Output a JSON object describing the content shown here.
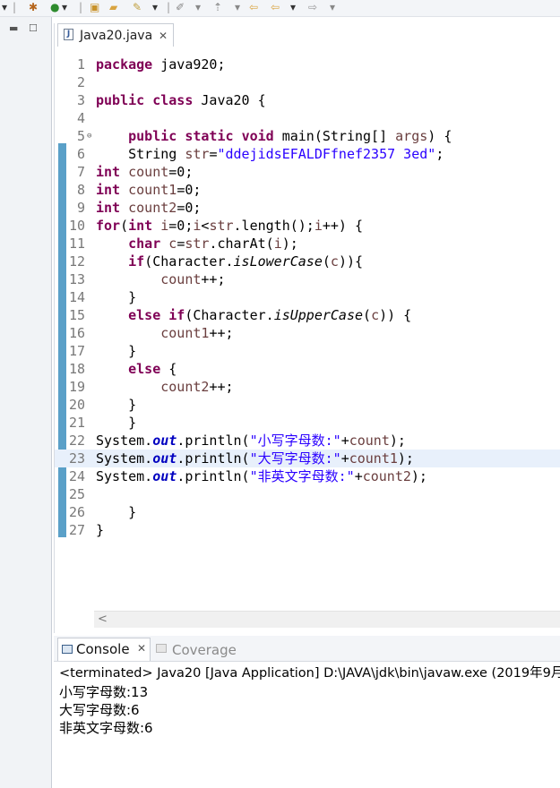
{
  "editor": {
    "tab_title": "Java20.java",
    "file_icon_letter": "J",
    "lines": [
      {
        "num": "1",
        "tokens": [
          {
            "t": "package ",
            "c": "kw"
          },
          {
            "t": "java920;",
            "c": ""
          }
        ]
      },
      {
        "num": "2",
        "tokens": []
      },
      {
        "num": "3",
        "tokens": [
          {
            "t": "public ",
            "c": "kw"
          },
          {
            "t": "class ",
            "c": "kw"
          },
          {
            "t": "Java20 {",
            "c": ""
          }
        ]
      },
      {
        "num": "4",
        "tokens": []
      },
      {
        "num": "5",
        "fold": true,
        "tokens": [
          {
            "t": "    public ",
            "c": "kw"
          },
          {
            "t": "static ",
            "c": "kw"
          },
          {
            "t": "void ",
            "c": "kw"
          },
          {
            "t": "main(String[] ",
            "c": ""
          },
          {
            "t": "args",
            "c": "ann"
          },
          {
            "t": ") {",
            "c": ""
          }
        ]
      },
      {
        "num": "6",
        "tokens": [
          {
            "t": "    String ",
            "c": ""
          },
          {
            "t": "str",
            "c": "ann"
          },
          {
            "t": "=",
            "c": ""
          },
          {
            "t": "\"ddejidsEFALDFfnef2357 3ed\"",
            "c": "str"
          },
          {
            "t": ";",
            "c": ""
          }
        ]
      },
      {
        "num": "7",
        "tokens": [
          {
            "t": "int ",
            "c": "kw"
          },
          {
            "t": "count",
            "c": "ann"
          },
          {
            "t": "=0;",
            "c": ""
          }
        ]
      },
      {
        "num": "8",
        "tokens": [
          {
            "t": "int ",
            "c": "kw"
          },
          {
            "t": "count1",
            "c": "ann"
          },
          {
            "t": "=0;",
            "c": ""
          }
        ]
      },
      {
        "num": "9",
        "tokens": [
          {
            "t": "int ",
            "c": "kw"
          },
          {
            "t": "count2",
            "c": "ann"
          },
          {
            "t": "=0;",
            "c": ""
          }
        ]
      },
      {
        "num": "10",
        "tokens": [
          {
            "t": "for",
            "c": "kw"
          },
          {
            "t": "(",
            "c": ""
          },
          {
            "t": "int ",
            "c": "kw"
          },
          {
            "t": "i",
            "c": "ann"
          },
          {
            "t": "=0;",
            "c": ""
          },
          {
            "t": "i",
            "c": "ann"
          },
          {
            "t": "<",
            "c": ""
          },
          {
            "t": "str",
            "c": "ann"
          },
          {
            "t": ".length();",
            "c": ""
          },
          {
            "t": "i",
            "c": "ann"
          },
          {
            "t": "++) {",
            "c": ""
          }
        ]
      },
      {
        "num": "11",
        "tokens": [
          {
            "t": "    char ",
            "c": "kw"
          },
          {
            "t": "c",
            "c": "ann"
          },
          {
            "t": "=",
            "c": ""
          },
          {
            "t": "str",
            "c": "ann"
          },
          {
            "t": ".charAt(",
            "c": ""
          },
          {
            "t": "i",
            "c": "ann"
          },
          {
            "t": ");",
            "c": ""
          }
        ]
      },
      {
        "num": "12",
        "tokens": [
          {
            "t": "    if",
            "c": "kw"
          },
          {
            "t": "(Character.",
            "c": ""
          },
          {
            "t": "isLowerCase",
            "c": "ital"
          },
          {
            "t": "(",
            "c": ""
          },
          {
            "t": "c",
            "c": "ann"
          },
          {
            "t": ")){",
            "c": ""
          }
        ]
      },
      {
        "num": "13",
        "tokens": [
          {
            "t": "        count",
            "c": "ann"
          },
          {
            "t": "++;",
            "c": ""
          }
        ]
      },
      {
        "num": "14",
        "tokens": [
          {
            "t": "    }",
            "c": ""
          }
        ]
      },
      {
        "num": "15",
        "tokens": [
          {
            "t": "    else ",
            "c": "kw"
          },
          {
            "t": "if",
            "c": "kw"
          },
          {
            "t": "(Character.",
            "c": ""
          },
          {
            "t": "isUpperCase",
            "c": "ital"
          },
          {
            "t": "(",
            "c": ""
          },
          {
            "t": "c",
            "c": "ann"
          },
          {
            "t": ")) {",
            "c": ""
          }
        ]
      },
      {
        "num": "16",
        "tokens": [
          {
            "t": "        count1",
            "c": "ann"
          },
          {
            "t": "++;",
            "c": ""
          }
        ]
      },
      {
        "num": "17",
        "tokens": [
          {
            "t": "    }",
            "c": ""
          }
        ]
      },
      {
        "num": "18",
        "tokens": [
          {
            "t": "    else ",
            "c": "kw"
          },
          {
            "t": "{",
            "c": ""
          }
        ]
      },
      {
        "num": "19",
        "tokens": [
          {
            "t": "        count2",
            "c": "ann"
          },
          {
            "t": "++;",
            "c": ""
          }
        ]
      },
      {
        "num": "20",
        "tokens": [
          {
            "t": "    }",
            "c": ""
          }
        ]
      },
      {
        "num": "21",
        "tokens": [
          {
            "t": "    }",
            "c": ""
          }
        ]
      },
      {
        "num": "22",
        "tokens": [
          {
            "t": "System.",
            "c": ""
          },
          {
            "t": "out",
            "c": "ifld"
          },
          {
            "t": ".println(",
            "c": ""
          },
          {
            "t": "\"小写字母数:\"",
            "c": "str"
          },
          {
            "t": "+",
            "c": ""
          },
          {
            "t": "count",
            "c": "ann"
          },
          {
            "t": ");",
            "c": ""
          }
        ]
      },
      {
        "num": "23",
        "highlight": true,
        "tokens": [
          {
            "t": "System.",
            "c": ""
          },
          {
            "t": "out",
            "c": "ifld"
          },
          {
            "t": ".println(",
            "c": ""
          },
          {
            "t": "\"大写字母数:\"",
            "c": "str"
          },
          {
            "t": "+",
            "c": ""
          },
          {
            "t": "count1",
            "c": "ann"
          },
          {
            "t": ");",
            "c": ""
          }
        ]
      },
      {
        "num": "24",
        "tokens": [
          {
            "t": "System.",
            "c": ""
          },
          {
            "t": "out",
            "c": "ifld"
          },
          {
            "t": ".println(",
            "c": ""
          },
          {
            "t": "\"非英文字母数:\"",
            "c": "str"
          },
          {
            "t": "+",
            "c": ""
          },
          {
            "t": "count2",
            "c": "ann"
          },
          {
            "t": ");",
            "c": ""
          }
        ]
      },
      {
        "num": "25",
        "tokens": []
      },
      {
        "num": "26",
        "tokens": [
          {
            "t": "    }",
            "c": ""
          }
        ]
      },
      {
        "num": "27",
        "tokens": [
          {
            "t": "}",
            "c": ""
          }
        ]
      }
    ]
  },
  "console": {
    "tab_label": "Console",
    "coverage_label": "Coverage",
    "status": "<terminated> Java20 [Java Application] D:\\JAVA\\jdk\\bin\\javaw.exe (2019年9月",
    "output": [
      "小写字母数:13",
      "大写字母数:6",
      "非英文字母数:6"
    ]
  },
  "colors": {
    "keyword": "#7f0055",
    "string": "#2a00ff",
    "field": "#0000c0",
    "local_var": "#6a3e3e",
    "marker_bar": "#5aa0c8",
    "current_line": "#e8f0fb"
  },
  "icons": {
    "tab_close": "close-icon",
    "fold": "fold-collapse-icon",
    "scroll_left": "chevron-left-icon"
  }
}
